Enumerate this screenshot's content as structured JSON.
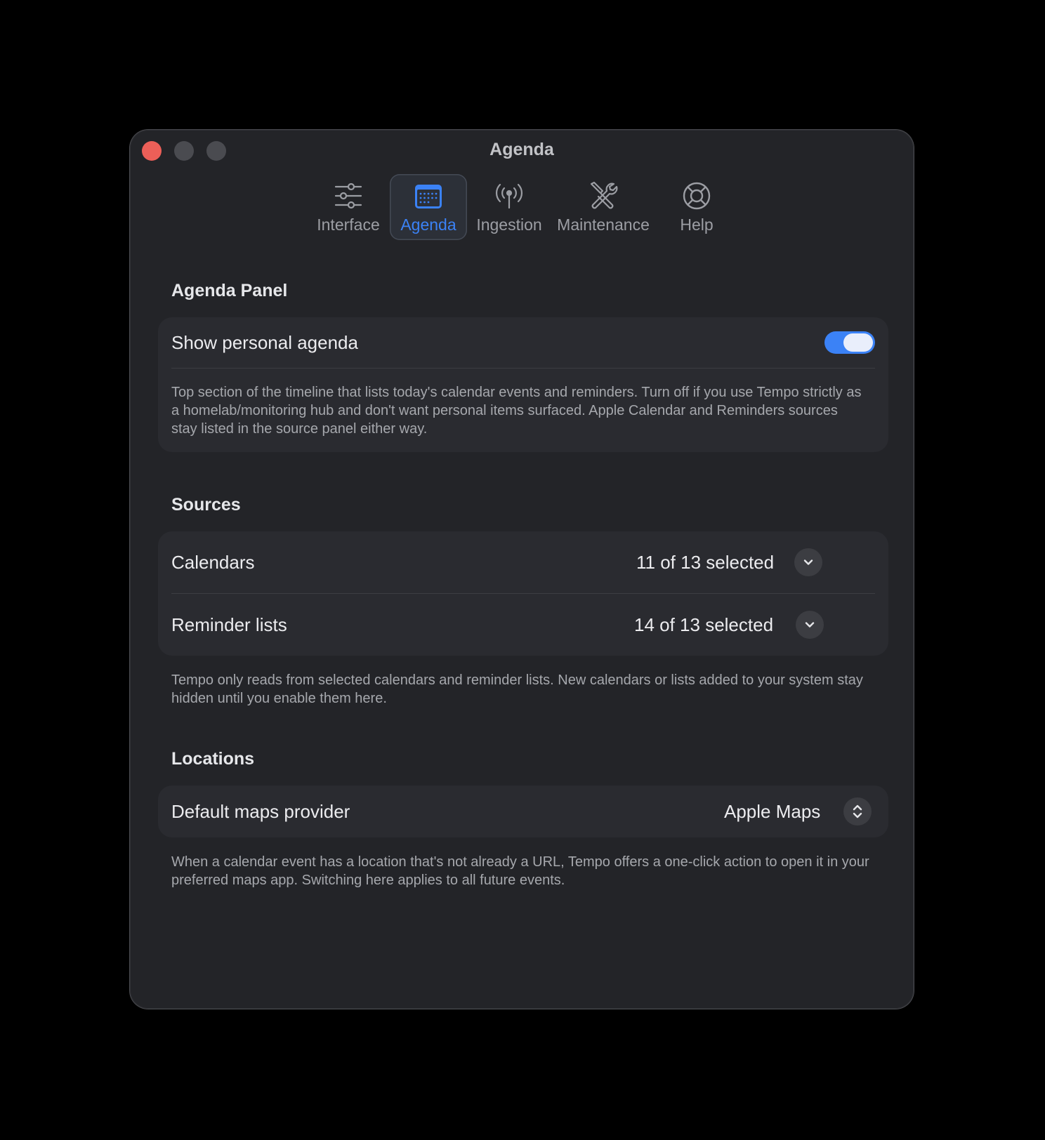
{
  "window": {
    "title": "Agenda"
  },
  "tabs": [
    {
      "label": "Interface",
      "icon": "sliders-icon",
      "active": false
    },
    {
      "label": "Agenda",
      "icon": "calendar-icon",
      "active": true
    },
    {
      "label": "Ingestion",
      "icon": "antenna-icon",
      "active": false
    },
    {
      "label": "Maintenance",
      "icon": "wrench-screwdriver-icon",
      "active": false
    },
    {
      "label": "Help",
      "icon": "lifebuoy-icon",
      "active": false
    }
  ],
  "agenda_panel": {
    "title": "Agenda Panel",
    "show_personal_agenda": {
      "label": "Show personal agenda",
      "enabled": true
    },
    "description": "Top section of the timeline that lists today's calendar events and reminders. Turn off if you use Tempo strictly as a homelab/monitoring hub and don't want personal items surfaced. Apple Calendar and Reminders sources stay listed in the source panel either way."
  },
  "sources": {
    "title": "Sources",
    "calendars": {
      "label": "Calendars",
      "value": "11 of 13 selected"
    },
    "reminder_lists": {
      "label": "Reminder lists",
      "value": "14 of 13 selected"
    },
    "description": "Tempo only reads from selected calendars and reminder lists. New calendars or lists added to your system stay hidden until you enable them here."
  },
  "locations": {
    "title": "Locations",
    "maps_provider": {
      "label": "Default maps provider",
      "value": "Apple Maps"
    },
    "description": "When a calendar event has a location that's not already a URL, Tempo offers a one-click action to open it in your preferred maps app. Switching here applies to all future events."
  },
  "colors": {
    "accent": "#3b82f6",
    "window_bg": "#232428",
    "card_bg": "#2a2b30",
    "close_button": "#ec5f58"
  }
}
